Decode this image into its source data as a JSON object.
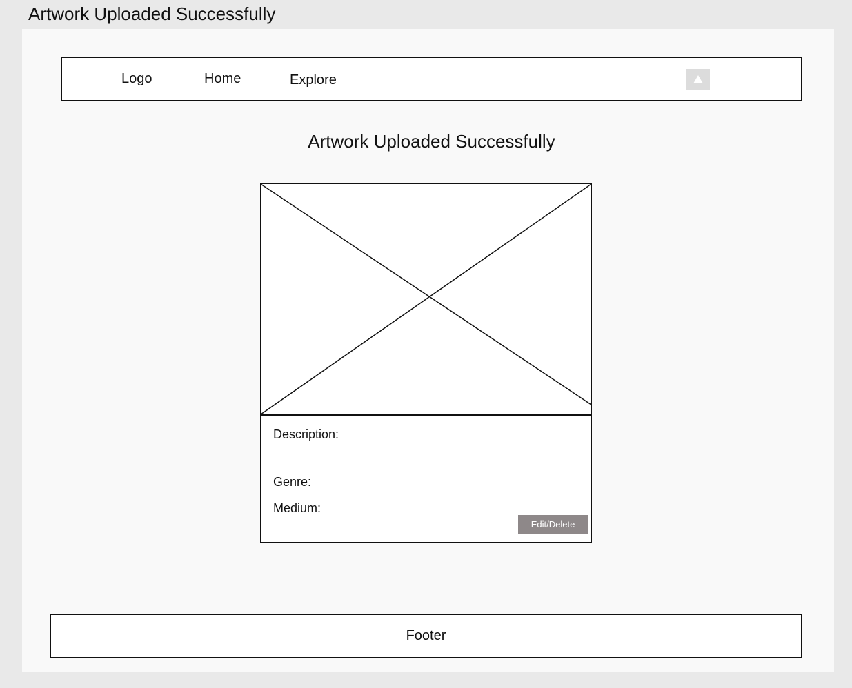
{
  "window": {
    "title": "Artwork Uploaded Successfully"
  },
  "navbar": {
    "logo": "Logo",
    "home": "Home",
    "explore": "Explore",
    "icon": "triangle-up-icon"
  },
  "main": {
    "heading": "Artwork Uploaded Successfully",
    "card": {
      "image": "image-placeholder",
      "description_label": "Description:",
      "genre_label": "Genre:",
      "medium_label": "Medium:",
      "action_label": "Edit/Delete"
    }
  },
  "footer": {
    "label": "Footer"
  },
  "colors": {
    "page_background": "#e9e9e9",
    "canvas_background": "#f9f9f9",
    "button_background": "#8e8889",
    "icon_button_background": "#dcdcdc"
  }
}
